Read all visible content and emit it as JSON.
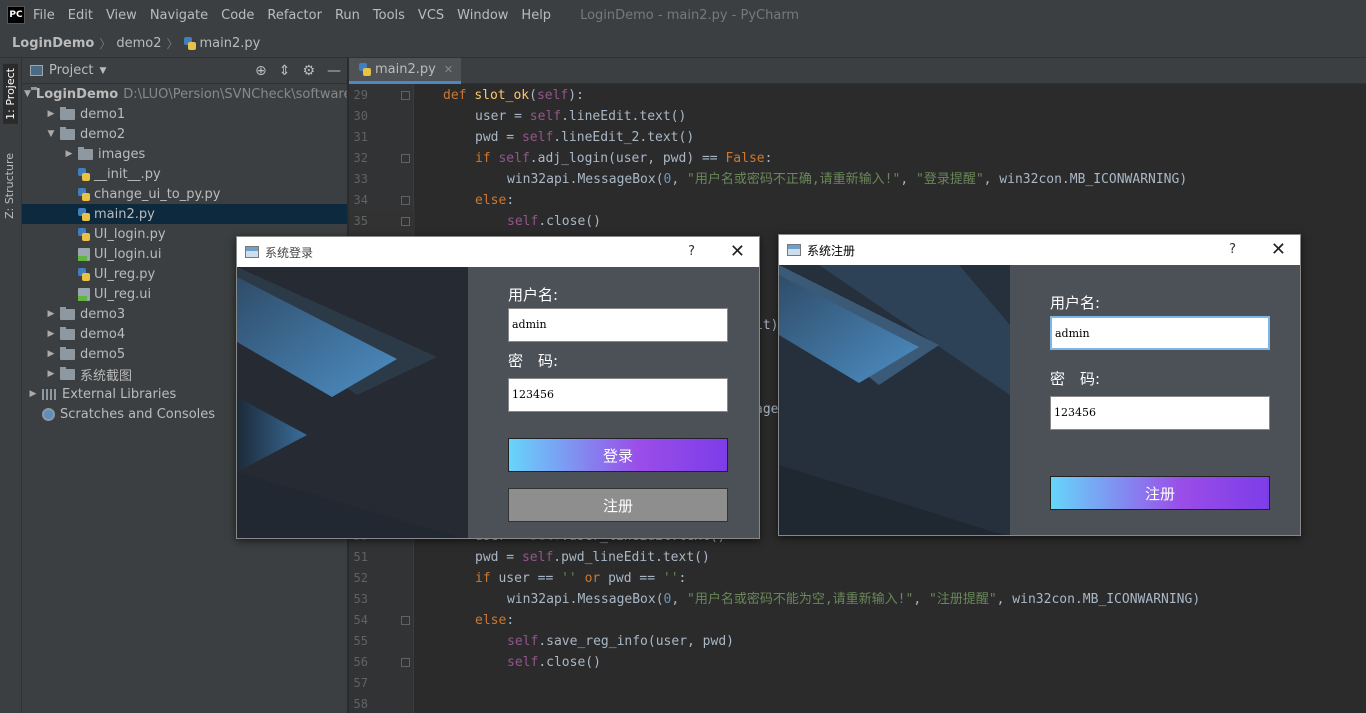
{
  "menubar": {
    "logo": "PC",
    "items": [
      "File",
      "Edit",
      "View",
      "Navigate",
      "Code",
      "Refactor",
      "Run",
      "Tools",
      "VCS",
      "Window",
      "Help"
    ],
    "title": "LoginDemo - main2.py - PyCharm"
  },
  "breadcrumb": {
    "project": "LoginDemo",
    "folder": "demo2",
    "file": "main2.py"
  },
  "sidetabs": {
    "project": "1: Project",
    "structure": "Z: Structure"
  },
  "project_panel": {
    "title": "Project",
    "root": {
      "name": "LoginDemo",
      "path": "D:\\LUO\\Persion\\SVNCheck\\software"
    },
    "items": [
      {
        "label": "demo1",
        "type": "folder",
        "depth": 1,
        "arrow": "right"
      },
      {
        "label": "demo2",
        "type": "folder",
        "depth": 1,
        "arrow": "down"
      },
      {
        "label": "images",
        "type": "folder",
        "depth": 2,
        "arrow": "right"
      },
      {
        "label": "__init__.py",
        "type": "py",
        "depth": 2,
        "arrow": ""
      },
      {
        "label": "change_ui_to_py.py",
        "type": "py",
        "depth": 2,
        "arrow": ""
      },
      {
        "label": "main2.py",
        "type": "py",
        "depth": 2,
        "arrow": "",
        "selected": true
      },
      {
        "label": "UI_login.py",
        "type": "py",
        "depth": 2,
        "arrow": ""
      },
      {
        "label": "UI_login.ui",
        "type": "ui",
        "depth": 2,
        "arrow": ""
      },
      {
        "label": "UI_reg.py",
        "type": "py",
        "depth": 2,
        "arrow": ""
      },
      {
        "label": "UI_reg.ui",
        "type": "ui",
        "depth": 2,
        "arrow": ""
      },
      {
        "label": "demo3",
        "type": "folder",
        "depth": 1,
        "arrow": "right"
      },
      {
        "label": "demo4",
        "type": "folder",
        "depth": 1,
        "arrow": "right"
      },
      {
        "label": "demo5",
        "type": "folder",
        "depth": 1,
        "arrow": "right"
      },
      {
        "label": "系统截图",
        "type": "folder",
        "depth": 1,
        "arrow": "right"
      },
      {
        "label": "External Libraries",
        "type": "libs",
        "depth": 0,
        "arrow": "right"
      },
      {
        "label": "Scratches and Consoles",
        "type": "scratch",
        "depth": 0,
        "arrow": ""
      }
    ]
  },
  "editor": {
    "tab": "main2.py",
    "lines": [
      {
        "n": "29",
        "code": [
          [
            "kw",
            "def "
          ],
          [
            "fn",
            "slot_ok"
          ],
          [
            "plain",
            "("
          ],
          [
            "self",
            "self"
          ],
          [
            "plain",
            "):"
          ]
        ],
        "indent": 1
      },
      {
        "n": "30",
        "code": [
          [
            "plain",
            "user = "
          ],
          [
            "self",
            "self"
          ],
          [
            "plain",
            ".lineEdit.text()"
          ]
        ],
        "indent": 2
      },
      {
        "n": "31",
        "code": [
          [
            "plain",
            "pwd = "
          ],
          [
            "self",
            "self"
          ],
          [
            "plain",
            ".lineEdit_2.text()"
          ]
        ],
        "indent": 2
      },
      {
        "n": "32",
        "code": [
          [
            "kw",
            "if "
          ],
          [
            "self",
            "self"
          ],
          [
            "plain",
            ".adj_login(user, pwd) == "
          ],
          [
            "kw",
            "False"
          ],
          [
            "plain",
            ":"
          ]
        ],
        "indent": 2
      },
      {
        "n": "33",
        "code": [
          [
            "plain",
            "win32api.MessageBox("
          ],
          [
            "num",
            "0"
          ],
          [
            "plain",
            ", "
          ],
          [
            "str",
            "\"用户名或密码不正确,请重新输入!\""
          ],
          [
            "plain",
            ", "
          ],
          [
            "str",
            "\"登录提醒\""
          ],
          [
            "plain",
            ", win32con.MB_ICONWARNING)"
          ]
        ],
        "indent": 3
      },
      {
        "n": "34",
        "code": [
          [
            "kw",
            "else"
          ],
          [
            "plain",
            ":"
          ]
        ],
        "indent": 2
      },
      {
        "n": "35",
        "code": [
          [
            "self",
            "self"
          ],
          [
            "plain",
            ".close()"
          ]
        ],
        "indent": 3
      },
      {
        "n": "50",
        "code": [
          [
            "plain",
            "user = "
          ],
          [
            "self",
            "self"
          ],
          [
            "plain",
            ".user_lineEdit.text()"
          ]
        ],
        "indent": 2
      },
      {
        "n": "51",
        "code": [
          [
            "plain",
            "pwd = "
          ],
          [
            "self",
            "self"
          ],
          [
            "plain",
            ".pwd_lineEdit.text()"
          ]
        ],
        "indent": 2
      },
      {
        "n": "52",
        "code": [
          [
            "kw",
            "if "
          ],
          [
            "plain",
            "user == "
          ],
          [
            "str",
            "''"
          ],
          [
            "kw",
            " or "
          ],
          [
            "plain",
            "pwd == "
          ],
          [
            "str",
            "''"
          ],
          [
            "plain",
            ":"
          ]
        ],
        "indent": 2
      },
      {
        "n": "53",
        "code": [
          [
            "plain",
            "win32api.MessageBox("
          ],
          [
            "num",
            "0"
          ],
          [
            "plain",
            ", "
          ],
          [
            "str",
            "\"用户名或密码不能为空,请重新输入!\""
          ],
          [
            "plain",
            ", "
          ],
          [
            "str",
            "\"注册提醒\""
          ],
          [
            "plain",
            ", win32con.MB_ICONWARNING)"
          ]
        ],
        "indent": 3
      },
      {
        "n": "54",
        "code": [
          [
            "kw",
            "else"
          ],
          [
            "plain",
            ":"
          ]
        ],
        "indent": 2
      },
      {
        "n": "55",
        "code": [
          [
            "self",
            "self"
          ],
          [
            "plain",
            ".save_reg_info(user, pwd)"
          ]
        ],
        "indent": 3
      },
      {
        "n": "56",
        "code": [
          [
            "self",
            "self"
          ],
          [
            "plain",
            ".close()"
          ]
        ],
        "indent": 3
      },
      {
        "n": "57",
        "code": [],
        "indent": 0
      },
      {
        "n": "58",
        "code": [],
        "indent": 0
      }
    ],
    "fragments": {
      "a": "it)",
      "b": "age"
    }
  },
  "login_dialog": {
    "title": "系统登录",
    "help": "?",
    "close": "✕",
    "user_label": "用户名:",
    "user_value": "admin",
    "pwd_label": "密　码:",
    "pwd_value": "123456",
    "login_button": "登录",
    "register_button": "注册"
  },
  "register_dialog": {
    "title": "系统注册",
    "help": "?",
    "close": "✕",
    "user_label": "用户名:",
    "user_value": "admin",
    "pwd_label": "密　码:",
    "pwd_value": "123456",
    "register_button": "注册"
  }
}
